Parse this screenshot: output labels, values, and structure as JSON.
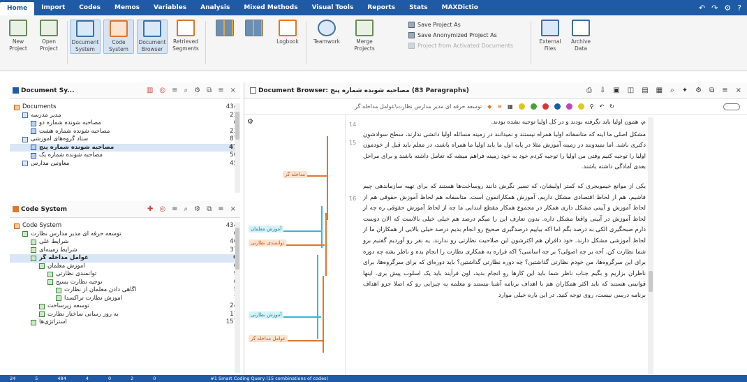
{
  "menu": {
    "tabs": [
      "Home",
      "Import",
      "Codes",
      "Memos",
      "Variables",
      "Analysis",
      "Mixed Methods",
      "Visual Tools",
      "Reports",
      "Stats",
      "MAXDictio"
    ],
    "active": "Home",
    "right_icons": [
      "undo-icon",
      "redo-icon",
      "settings-icon",
      "help-icon"
    ]
  },
  "ribbon": {
    "new_project": "New\nProject",
    "open_project": "Open\nProject",
    "document_system": "Document\nSystem",
    "code_system": "Code\nSystem",
    "document_browser": "Document\nBrowser",
    "retrieved_segments": "Retrieved\nSegments",
    "logbook": "Logbook",
    "teamwork": "Teamwork",
    "merge_projects": "Merge\nProjects",
    "save_project_as": "Save Project As",
    "save_anonymized": "Save Anonymized Project As",
    "third_option": "Project from Activated Documents",
    "external_files": "External\nFiles",
    "archive_data": "Archive\nData"
  },
  "doc_system": {
    "title": "Document Sy...",
    "items": [
      {
        "label": "Documents",
        "count": "434",
        "level": 0,
        "type": "root"
      },
      {
        "label": "مدیر مدرسه",
        "count": "23",
        "level": 1,
        "type": "set"
      },
      {
        "label": "مصاحبه شونده شماره دو",
        "count": "0",
        "level": 2,
        "type": "doc"
      },
      {
        "label": "مصاحبه شونده شماره هشت",
        "count": "23",
        "level": 2,
        "type": "doc"
      },
      {
        "label": "ستاد گروه‌های آموزشی",
        "count": "87",
        "level": 1,
        "type": "set"
      },
      {
        "label": "مصاحبه شونده شماره پنج",
        "count": "47",
        "level": 2,
        "type": "doc",
        "selected": true
      },
      {
        "label": "مصاحبه شونده شماره یک",
        "count": "50",
        "level": 2,
        "type": "doc"
      },
      {
        "label": "معاونین مدارس",
        "count": "45",
        "level": 1,
        "type": "set"
      }
    ]
  },
  "code_system": {
    "title": "Code System",
    "items": [
      {
        "label": "Code System",
        "count": "434",
        "level": 0,
        "type": "root"
      },
      {
        "label": "توسعه حرفه ای مدیر مدارس نظارت",
        "count": "0",
        "level": 1,
        "type": "code"
      },
      {
        "label": "شرایط علی",
        "count": "46",
        "level": 2,
        "type": "code"
      },
      {
        "label": "شرایط زمینه‌ای",
        "count": "37",
        "level": 2,
        "type": "code"
      },
      {
        "label": "عوامل مداخله گر",
        "count": "0",
        "level": 2,
        "type": "code",
        "selected": true
      },
      {
        "label": "آموزش معلمان",
        "count": "0",
        "level": 3,
        "type": "code"
      },
      {
        "label": "توانمندی نظارتی",
        "count": "9",
        "level": 4,
        "type": "code"
      },
      {
        "label": "توجیه نظارت بسیج",
        "count": "0",
        "level": 4,
        "type": "code"
      },
      {
        "label": "آگاهی دادن معلمان از نظارت",
        "count": "5",
        "level": 5,
        "type": "code"
      },
      {
        "label": "آموزش نظارت تراکسدا",
        "count": "7",
        "level": 5,
        "type": "code"
      },
      {
        "label": "توسعه زیرساخت",
        "count": "24",
        "level": 3,
        "type": "code"
      },
      {
        "label": "به روز رسانی ساختار نظارت",
        "count": "17",
        "level": 3,
        "type": "code"
      },
      {
        "label": "استراتژی‌ها",
        "count": "157",
        "level": 2,
        "type": "code"
      }
    ]
  },
  "browser": {
    "title": "Document Browser: مصاحبه شونده شماره پنج (83 Paragraphs)",
    "breadcrumb": "توسعه حرفه ای مدیر مدارس نظارت\\عوامل مداخله گر",
    "para_numbers": [
      "14",
      "15",
      "16"
    ],
    "paragraphs": [
      "م، همون اولیا باید نگرفته بودند و در کل اولیا توجیه نشده بودند.",
      "مشکل اصلی ما اینه که متاسفانه اولیا همراه نیستند و نمیدانند در زمینه مسائله اولیا دانشی ندارند، سطح سوادشون دکتری باشد. اما نمیدونند در زمینه آموزش مثلا در پایه اول ما باید اولیا ما همراه باشند، در معلم باید قبل از خودمون اولیا را توجیه کنیم وقتی من اولیا را توجیه کردم خود به خود زمینه فراهم میشه که تعامل داشته باشند و برای مراحل بعدی آمادگی داشته باشند.",
      "یکی از موانع خیمویجری که کمتر اولیشان، که تصیر نگرش دانند روساخت‌ها هستند که برای تهیه سازماندهی چیم فاشیم، هم از لحاظ اقتصادی مشکل داریم. آموزش همکارانمون است، متاسفانه هم لحاظ آموزش حقوقی هم از لحاظ آموزش و آیینی مشکل داری همکار در مجموع همکار مقطع ابتدایی ما چه از لحاظ آموزش حقوقی ره چه از لحاظ آموزش در آیینی واقعا مشکل داره. بدون تعارف این را میگم درصد هم خیلی خیلی بالاست که الان دوست دارم صبحگیری الکی به درصد بگم اما اکه بیاییم درصدگیری صحیح رو انجام بدیم درصد خیلی بالایی از همکاران ما از لحاظ آموزشی مشکل دارند. خود دافران هم اکثرشون این صلاحیت نظارتی رو ندارند. یه نفر رو آوردیم گفتیم برو شما نظارت کن. آخه بر چه اصولی؟ بر چه اساسی؟ اکه قراره به همکاری نظارت را انجام بده و ناظر بشه چه دوره برای این سرگروه‌ها. من خودم نظارتی گذاشتین؟ چه دوره نظارتی گذاشتین؟ باید دوره‌ای که برای سرگروه‌ها، برای ناظران بزاریم و بگیم جناب ناظر شما باید این کارها رو انجام بدید، اون فرآیند باید یک اسلوب پیش بری. اینها قوانینی هستند که باید اکثر همکاران هم با اهداف برنامه آشنا نیستند و معلمه یه چیزایی رو که اصلا جزو اهداف برنامه درسی نیست، روی توجه کنید. در این باره خیلی موارد"
    ],
    "code_labels": [
      "مداخله گر",
      "آموزش معلمان",
      "توانمندی نظارتی",
      "آموزش نظارتی",
      "عوامل مداخله گر"
    ]
  },
  "status": {
    "items": [
      "24",
      "5",
      "484",
      "4",
      "0",
      "2",
      "0"
    ],
    "message": "#1 Smart Coding Query (15 combinations of codes)"
  },
  "colors": {
    "brand": "#1f5aa6",
    "orange": "#e2762c",
    "cyan": "#35b8d8",
    "green": "#6a8a5a"
  }
}
